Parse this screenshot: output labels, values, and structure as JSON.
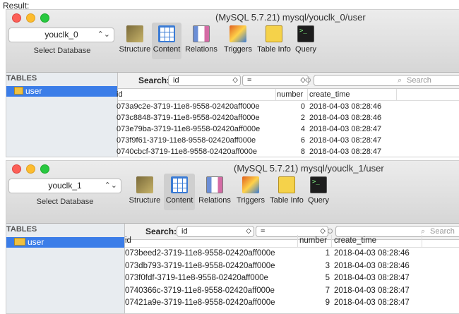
{
  "result_label": "Result:",
  "windows": [
    {
      "title": "(MySQL 5.7.21) mysql/youclk_0/user",
      "database": "youclk_0",
      "select_db_label": "Select Database",
      "toolbar": [
        "Structure",
        "Content",
        "Relations",
        "Triggers",
        "Table Info",
        "Query"
      ],
      "tables_header": "TABLES",
      "table_name": "user",
      "search_label": "Search:",
      "field": "id",
      "operator": "=",
      "search_placeholder": "Search",
      "columns": [
        "id",
        "number",
        "create_time"
      ],
      "rows": [
        [
          "073a9c2e-3719-11e8-9558-02420aff000e",
          "0",
          "2018-04-03 08:28:46"
        ],
        [
          "073c8848-3719-11e8-9558-02420aff000e",
          "2",
          "2018-04-03 08:28:46"
        ],
        [
          "073e79ba-3719-11e8-9558-02420aff000e",
          "4",
          "2018-04-03 08:28:47"
        ],
        [
          "073f9f61-3719-11e8-9558-02420aff000e",
          "6",
          "2018-04-03 08:28:47"
        ],
        [
          "0740cbcf-3719-11e8-9558-02420aff000e",
          "8",
          "2018-04-03 08:28:47"
        ]
      ]
    },
    {
      "title": "(MySQL 5.7.21) mysql/youclk_1/user",
      "database": "youclk_1",
      "select_db_label": "Select Database",
      "toolbar": [
        "Structure",
        "Content",
        "Relations",
        "Triggers",
        "Table Info",
        "Query"
      ],
      "tables_header": "TABLES",
      "table_name": "user",
      "search_label": "Search:",
      "field": "id",
      "operator": "=",
      "search_placeholder": "Search",
      "columns": [
        "id",
        "number",
        "create_time"
      ],
      "rows": [
        [
          "073beed2-3719-11e8-9558-02420aff000e",
          "1",
          "2018-04-03 08:28:46"
        ],
        [
          "073db793-3719-11e8-9558-02420aff000e",
          "3",
          "2018-04-03 08:28:46"
        ],
        [
          "073f0fdf-3719-11e8-9558-02420aff000e",
          "5",
          "2018-04-03 08:28:47"
        ],
        [
          "0740366c-3719-11e8-9558-02420aff000e",
          "7",
          "2018-04-03 08:28:47"
        ],
        [
          "07421a9e-3719-11e8-9558-02420aff000e",
          "9",
          "2018-04-03 08:28:47"
        ]
      ]
    }
  ]
}
